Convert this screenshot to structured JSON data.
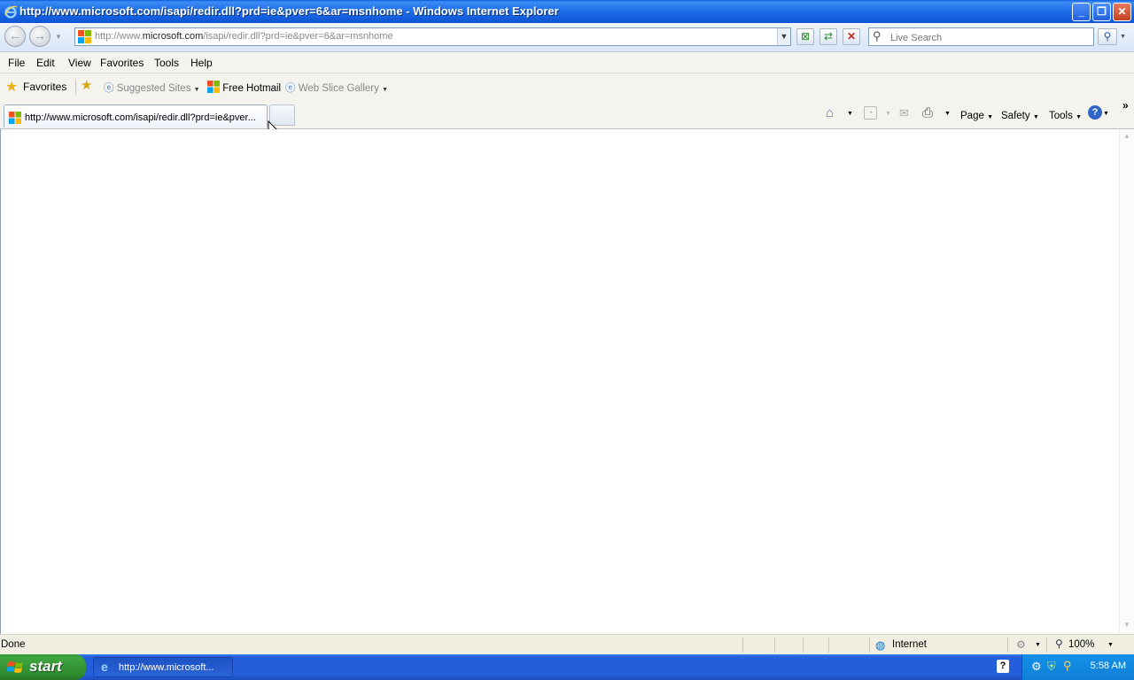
{
  "window": {
    "title": "http://www.microsoft.com/isapi/redir.dll?prd=ie&pver=6&ar=msnhome - Windows Internet Explorer"
  },
  "address_bar": {
    "url_prefix": "http://www.",
    "url_domain": "microsoft.com",
    "url_path": "/isapi/redir.dll?prd=ie&pver=6&ar=msnhome"
  },
  "search": {
    "placeholder": "Live Search"
  },
  "menu": [
    "File",
    "Edit",
    "View",
    "Favorites",
    "Tools",
    "Help"
  ],
  "favorites_bar": {
    "favorites_label": "Favorites",
    "suggested_sites": "Suggested Sites",
    "free_hotmail": "Free Hotmail",
    "web_slice_gallery": "Web Slice Gallery"
  },
  "tab": {
    "title": "http://www.microsoft.com/isapi/redir.dll?prd=ie&pver..."
  },
  "command_bar": {
    "page": "Page",
    "safety": "Safety",
    "tools": "Tools"
  },
  "status_bar": {
    "status": "Done",
    "zone": "Internet",
    "zoom": "100%"
  },
  "taskbar": {
    "start_label": "start",
    "task_button": "http://www.microsoft...",
    "clock": "5:58 AM"
  },
  "colors": {
    "titlebar": "#0d54d6",
    "taskbar": "#245edb",
    "start": "#3fa43f",
    "tray": "#0f7fd6"
  }
}
